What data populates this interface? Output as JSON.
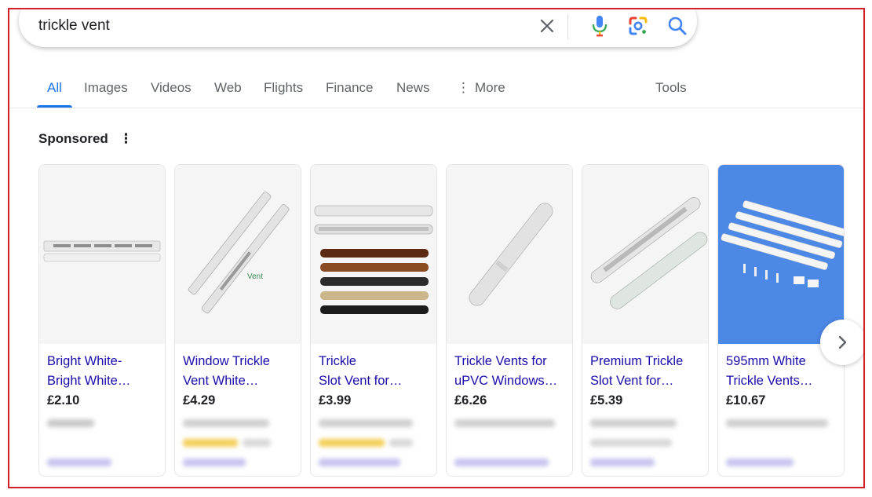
{
  "search": {
    "query": "trickle vent"
  },
  "tabs": [
    {
      "label": "All"
    },
    {
      "label": "Images"
    },
    {
      "label": "Videos"
    },
    {
      "label": "Web"
    },
    {
      "label": "Flights"
    },
    {
      "label": "Finance"
    },
    {
      "label": "News"
    },
    {
      "label": "More"
    }
  ],
  "tools_label": "Tools",
  "sponsored_label": "Sponsored",
  "products": [
    {
      "title_line1": "Bright White-",
      "title_line2": "Bright White…",
      "price": "£2.10",
      "image_icon": "white-trickle-vent-image"
    },
    {
      "title_line1": "Window Trickle",
      "title_line2": "Vent White…",
      "price": "£4.29",
      "image_icon": "diagonal-trickle-vents-image"
    },
    {
      "title_line1": "Trickle",
      "title_line2": "Slot Vent for…",
      "price": "£3.99",
      "image_icon": "coloured-trickle-vents-image"
    },
    {
      "title_line1": "Trickle Vents for",
      "title_line2": "uPVC Windows…",
      "price": "£6.26",
      "image_icon": "single-trickle-vent-image"
    },
    {
      "title_line1": "Premium Trickle",
      "title_line2": "Slot Vent for…",
      "price": "£5.39",
      "image_icon": "slot-vent-pair-image"
    },
    {
      "title_line1": "595mm White",
      "title_line2": "Trickle Vents…",
      "price": "£10.67",
      "image_icon": "white-vent-set-image"
    }
  ],
  "colors": {
    "accent": "#1a73e8",
    "link": "#1a0dab",
    "frame_border": "#d71f26",
    "last_card_bg": "#4c88e6"
  },
  "icons": [
    "close-icon",
    "mic-icon",
    "google-lens-icon",
    "search-icon",
    "more-vert-icon",
    "chevron-right-icon"
  ]
}
